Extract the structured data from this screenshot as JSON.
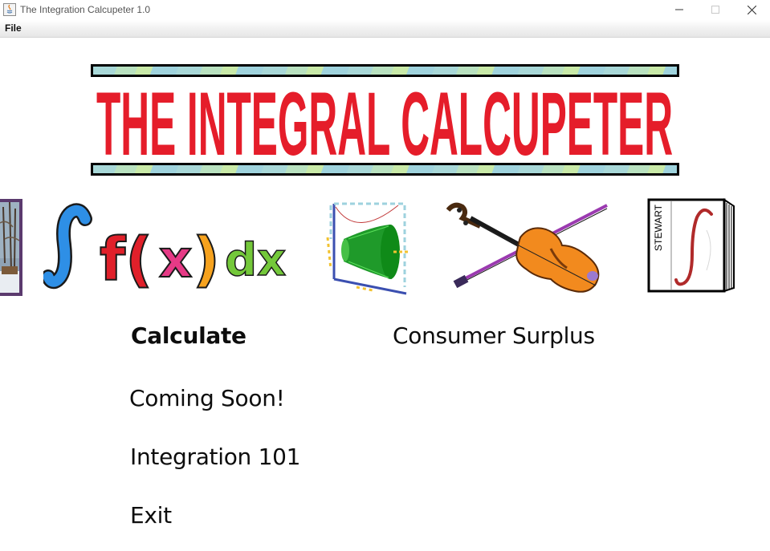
{
  "window": {
    "title": "The Integration Calcupeter 1.0"
  },
  "menubar": {
    "file_label": "File"
  },
  "banner": {
    "title": "THE INTEGRAL CALCUPETER"
  },
  "images": {
    "formula_parts": [
      "∫",
      "f(",
      "x",
      ")",
      "dx"
    ],
    "book_spine": "STEWART"
  },
  "menu": {
    "calculate": "Calculate",
    "consumer_surplus": "Consumer Surplus",
    "coming_soon": "Coming Soon!",
    "integration_101": "Integration 101",
    "exit": "Exit"
  },
  "colors": {
    "banner_red": "#e51d2a",
    "accent_green": "#149414"
  }
}
